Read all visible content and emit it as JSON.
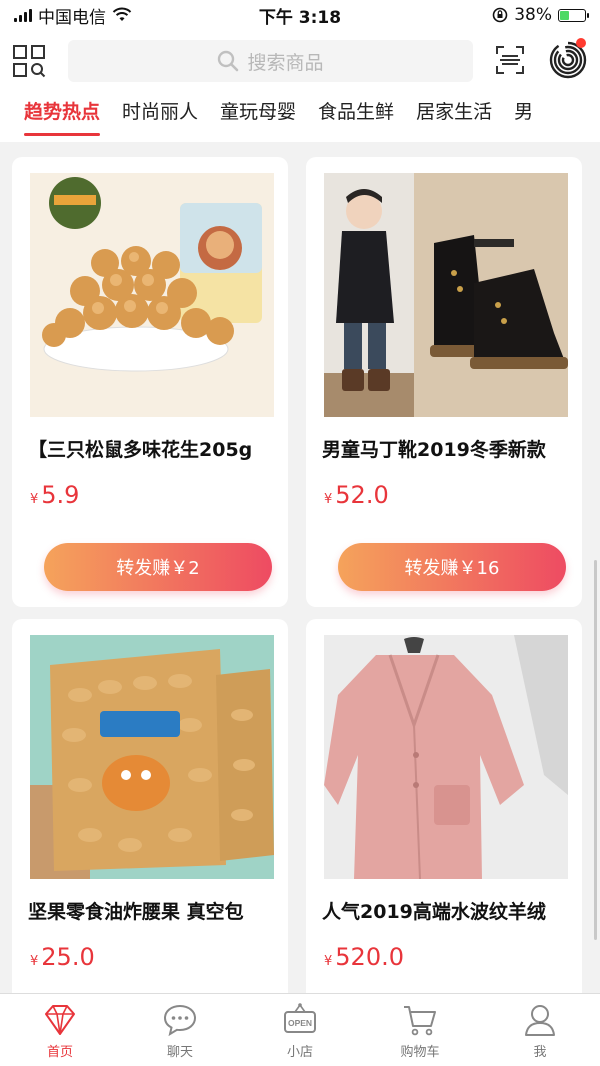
{
  "status": {
    "carrier": "中国电信",
    "time": "下午 3:18",
    "battery": "38%",
    "battery_level": 0.38
  },
  "header": {
    "search_placeholder": "搜索商品"
  },
  "tabs": [
    {
      "label": "趋势热点"
    },
    {
      "label": "时尚丽人"
    },
    {
      "label": "童玩母婴"
    },
    {
      "label": "食品生鲜"
    },
    {
      "label": "居家生活"
    },
    {
      "label": "男"
    }
  ],
  "products": [
    {
      "title": "【三只松鼠多味花生205g",
      "currency": "¥",
      "price": "5.9",
      "share": "转发赚￥2"
    },
    {
      "title": "男童马丁靴2019冬季新款",
      "currency": "¥",
      "price": "52.0",
      "share": "转发赚￥16"
    },
    {
      "title": "坚果零食油炸腰果 真空包",
      "currency": "¥",
      "price": "25.0"
    },
    {
      "title": "人气2019高端水波纹羊绒",
      "currency": "¥",
      "price": "520.0"
    }
  ],
  "tabbar": [
    {
      "label": "首页"
    },
    {
      "label": "聊天"
    },
    {
      "label": "小店",
      "icon_text": "OPEN"
    },
    {
      "label": "购物车"
    },
    {
      "label": "我"
    }
  ],
  "colors": {
    "accent": "#e8353b",
    "gradient_start": "#f5a35b",
    "gradient_end": "#ee4b62"
  }
}
